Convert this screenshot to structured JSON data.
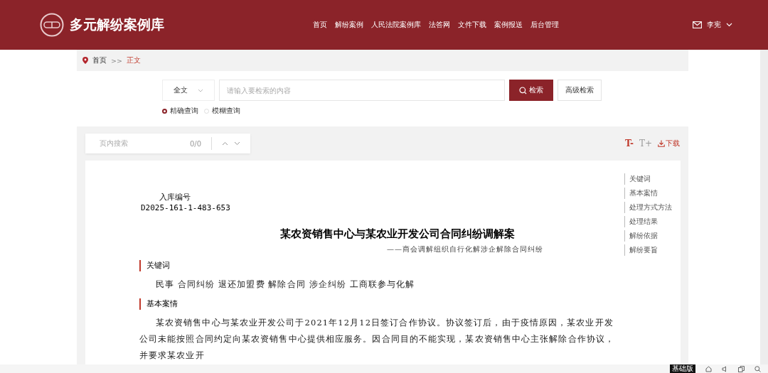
{
  "header": {
    "site_name": "多元解纷案例库",
    "nav": [
      {
        "label": "首页"
      },
      {
        "label": "解纷案例"
      },
      {
        "label": "人民法院案例库"
      },
      {
        "label": "法答网"
      },
      {
        "label": "文件下载"
      },
      {
        "label": "案例报送"
      },
      {
        "label": "后台管理"
      }
    ],
    "user": "李宪"
  },
  "breadcrumb": [
    {
      "label": "首页",
      "current": false
    },
    {
      "label": "正文",
      "current": true
    }
  ],
  "breadcrumb_separator": ">>",
  "search": {
    "scope": "全文",
    "placeholder": "请输入要检索的内容",
    "button": "检索",
    "advanced": "高级检索",
    "modes": [
      {
        "label": "精确查询",
        "selected": true
      },
      {
        "label": "模糊查询",
        "selected": false
      }
    ]
  },
  "page_search": {
    "placeholder": "页内搜索",
    "count": "0/0"
  },
  "tools": {
    "font_smaller": "T-",
    "font_larger": "T+",
    "download": "下载"
  },
  "document": {
    "id_label": "入库编号",
    "id": "D2025-161-1-483-653",
    "title": "某农资销售中心与某农业开发公司合同纠纷调解案",
    "subtitle": "——商会调解组织自行化解涉企解除合同纠纷",
    "sections": [
      {
        "heading": "关键词",
        "paragraphs": [
          "民事 合同纠纷 退还加盟费 解除合同 涉企纠纷 工商联参与化解"
        ]
      },
      {
        "heading": "基本案情",
        "paragraphs": [
          "某农资销售中心与某农业开发公司于2021年12月12日签订合作协议。协议签订后，由于疫情原因，某农业开发公司未能按照合同约定向某农资销售中心提供相应服务。因合同目的不能实现，某农资销售中心主张解除合作协议，并要求某农业开"
        ]
      }
    ]
  },
  "toc": [
    {
      "label": "关键词"
    },
    {
      "label": "基本案情"
    },
    {
      "label": "处理方式方法"
    },
    {
      "label": "处理结果"
    },
    {
      "label": "解纷依据"
    },
    {
      "label": "解纷要旨"
    }
  ],
  "bottom_bar": {
    "badge": "基础版"
  }
}
